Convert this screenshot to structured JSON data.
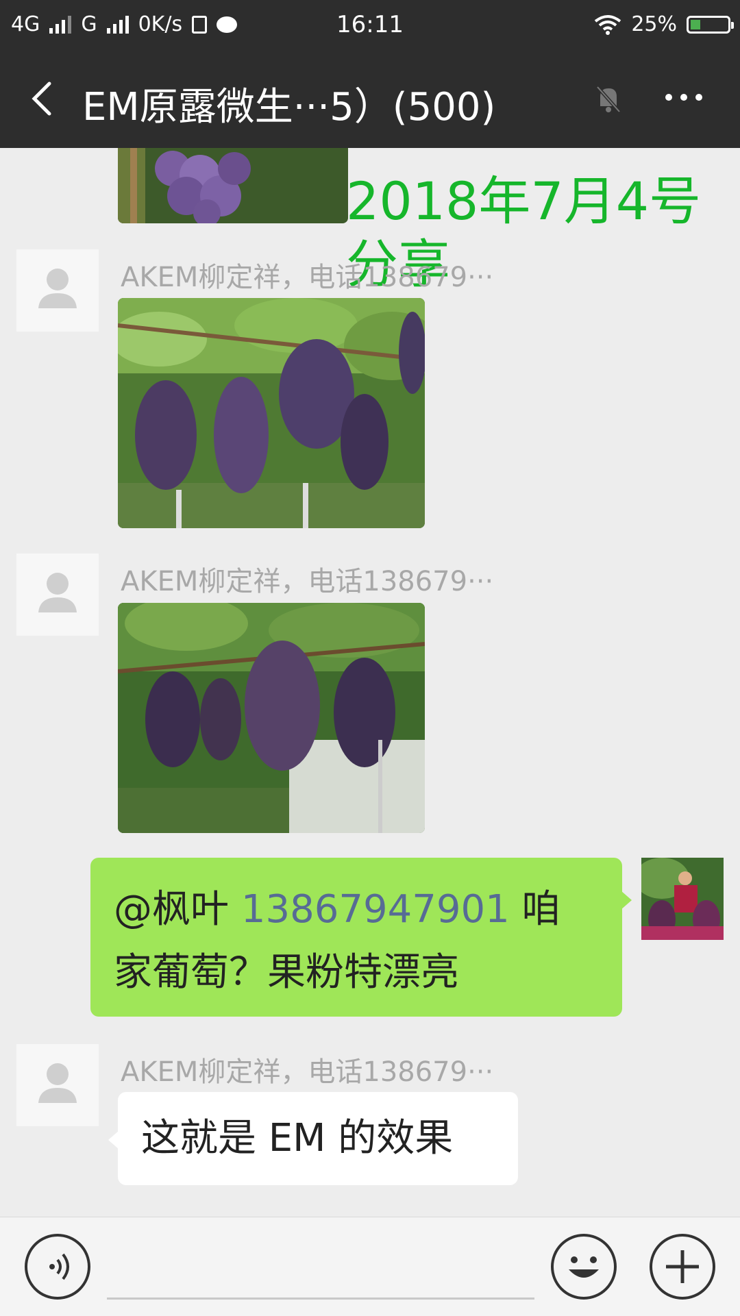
{
  "status_bar": {
    "network_1": "4G",
    "network_2": "G",
    "speed": "0K/s",
    "time": "16:11",
    "battery": "25%"
  },
  "header": {
    "title": "EM原露微生···5）(500)"
  },
  "chat": {
    "overlay": {
      "line1": "2018年7月4号",
      "line2": "分享"
    },
    "messages": [
      {
        "sender": "AKEM柳定祥，电话138679···",
        "type": "image",
        "alt": "grapes photo"
      },
      {
        "sender": "AKEM柳定祥，电话138679···",
        "type": "image",
        "alt": "grapes photo"
      },
      {
        "self": true,
        "mention": "@枫叶",
        "phone": "13867947901",
        "text_after": " 咱",
        "text_line2": "家葡萄？果粉特漂亮"
      },
      {
        "sender": "AKEM柳定祥，电话138679···",
        "type": "text",
        "text": "这就是 EM 的效果"
      }
    ]
  },
  "colors": {
    "header_bg": "#2d2d2d",
    "chat_bg": "#ededed",
    "self_bubble": "#9fe658",
    "link_blue": "#576b95",
    "overlay_green": "#16b62b"
  }
}
